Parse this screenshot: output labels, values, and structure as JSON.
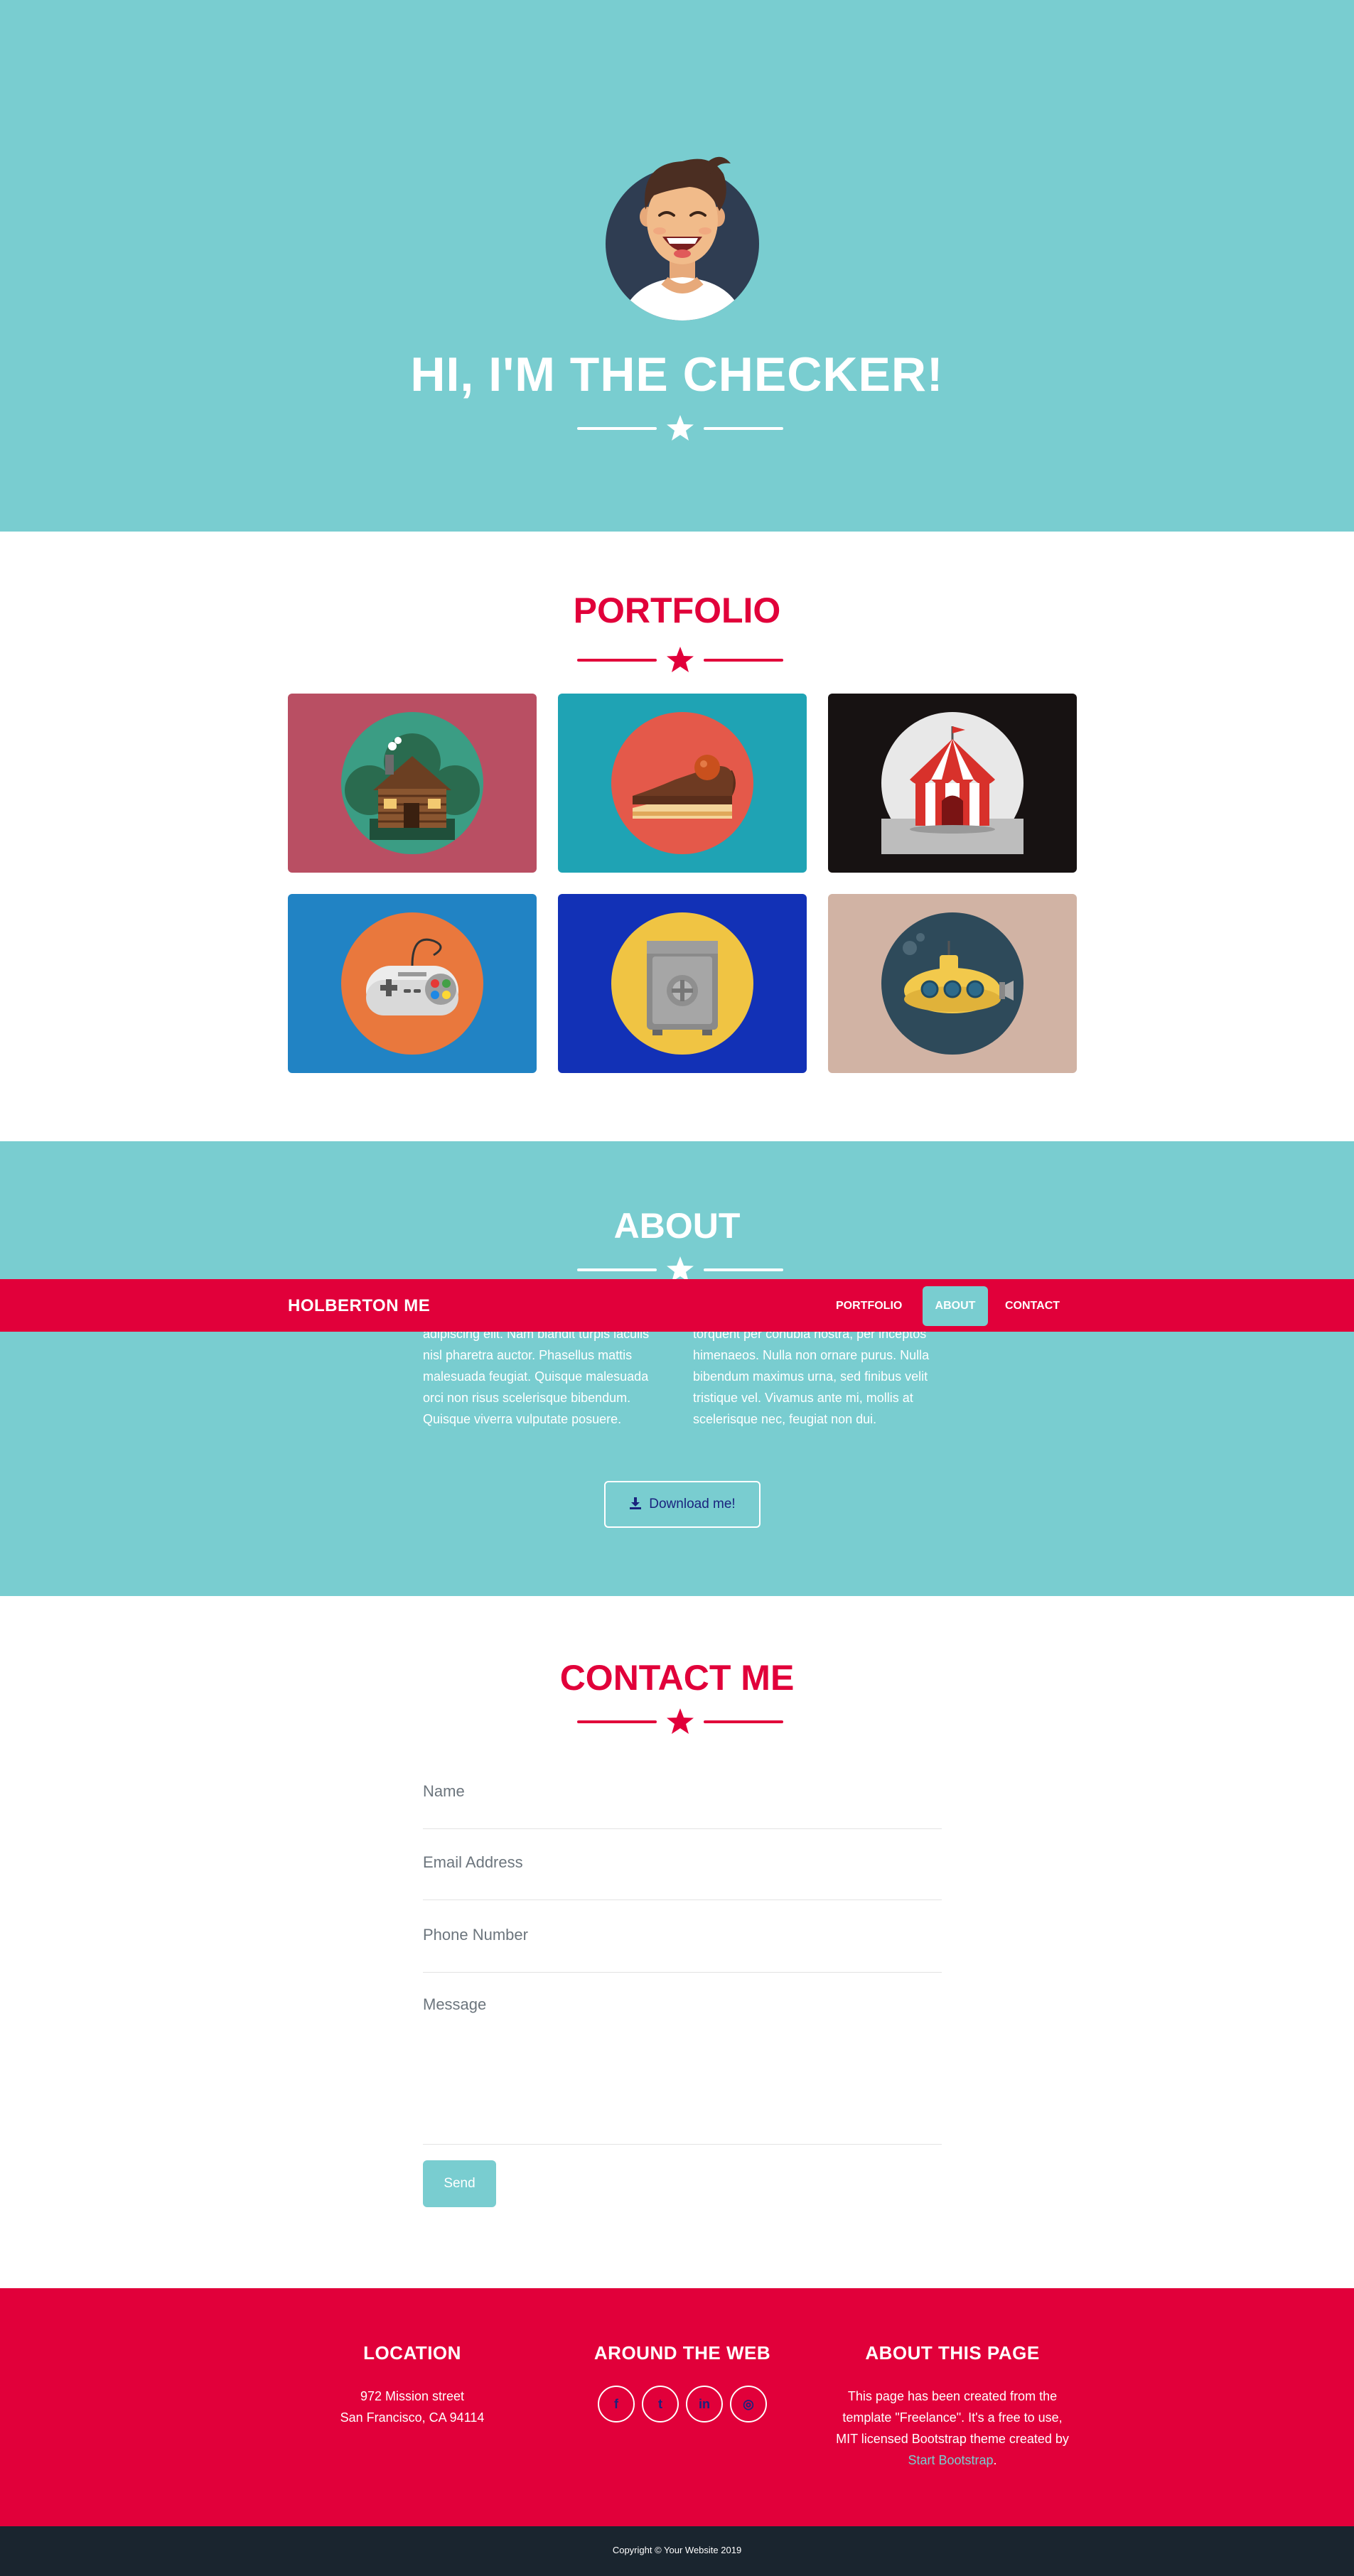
{
  "masthead": {
    "title": "HI, I'M THE CHECKER!"
  },
  "portfolio": {
    "title": "PORTFOLIO",
    "items": [
      {
        "icon": "cabin-icon",
        "bg": "#b94f63",
        "circle": "#3b9d84"
      },
      {
        "icon": "cake-icon",
        "bg": "#1fa3b4",
        "circle": "#e4594a"
      },
      {
        "icon": "circus-tent-icon",
        "bg": "#171212",
        "circle": "#e8e8e8"
      },
      {
        "icon": "game-controller-icon",
        "bg": "#2183c4",
        "circle": "#e9783d"
      },
      {
        "icon": "safe-icon",
        "bg": "#1231b6",
        "circle": "#f0c443"
      },
      {
        "icon": "submarine-icon",
        "bg": "#d1b3a4",
        "circle": "#2e4a5a"
      }
    ]
  },
  "about": {
    "title": "ABOUT",
    "left_text": "adipiscing elit. Nam blandit turpis iaculis nisl pharetra auctor. Phasellus mattis malesuada feugiat. Quisque malesuada orci non risus scelerisque bibendum. Quisque viverra vulputate posuere.",
    "right_text": "torquent per conubia nostra, per inceptos himenaeos. Nulla non ornare purus. Nulla bibendum maximus urna, sed finibus velit tristique vel. Vivamus ante mi, mollis at scelerisque nec, feugiat non dui.",
    "download_label": "Download me!"
  },
  "navbar": {
    "brand": "HOLBERTON ME",
    "links": [
      "PORTFOLIO",
      "ABOUT",
      "CONTACT"
    ],
    "active": "ABOUT"
  },
  "contact": {
    "title": "CONTACT ME",
    "name_placeholder": "Name",
    "email_placeholder": "Email Address",
    "phone_placeholder": "Phone Number",
    "message_placeholder": "Message",
    "send_label": "Send"
  },
  "footer": {
    "location": {
      "title": "LOCATION",
      "line1": "972 Mission street",
      "line2": "San Francisco, CA 94114"
    },
    "web": {
      "title": "AROUND THE WEB",
      "icons": [
        "facebook-icon",
        "twitter-icon",
        "linkedin-icon",
        "dribbble-icon"
      ],
      "glyphs": [
        "f",
        "t",
        "in",
        "◎"
      ]
    },
    "about_page": {
      "title": "ABOUT THIS PAGE",
      "text": "This page has been created from the template \"Freelance\". It's a free to use, MIT licensed Bootstrap theme created by",
      "link_text": "Start Bootstrap",
      "end": "."
    }
  },
  "copyright": "Copyright © Your Website 2019",
  "colors": {
    "teal": "#79cdd0",
    "red": "#e1003a",
    "dark": "#1a252f",
    "navy_text": "#1a237e"
  }
}
